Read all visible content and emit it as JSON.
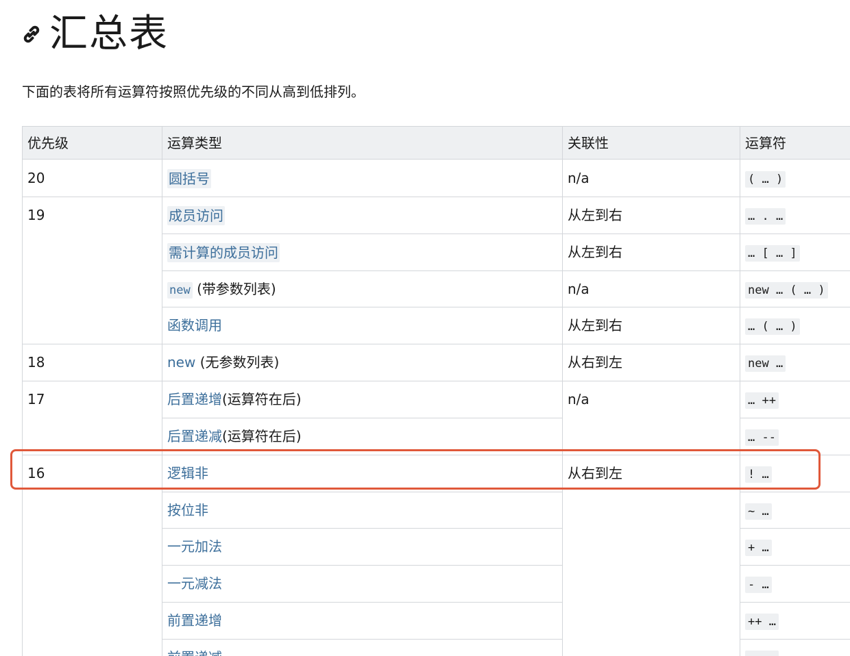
{
  "heading": {
    "title": "汇总表",
    "icon": "link-icon"
  },
  "intro": "下面的表将所有运算符按照优先级的不同从高到低排列。",
  "table": {
    "headers": [
      "优先级",
      "运算类型",
      "关联性",
      "运算符"
    ],
    "rows": [
      {
        "precedence": "20",
        "type": "圆括号",
        "assoc": "n/a",
        "op": "( … )"
      },
      {
        "precedence": "19",
        "type": "成员访问",
        "assoc": "从左到右",
        "op": "… . …"
      },
      {
        "type": "需计算的成员访问",
        "assoc": "从左到右",
        "op": "… [ … ]"
      },
      {
        "type_code": "new",
        "type_suffix": "(带参数列表)",
        "assoc": "n/a",
        "op": "new … ( … )"
      },
      {
        "type": "函数调用",
        "assoc": "从左到右",
        "op": "… ( … )"
      },
      {
        "precedence": "18",
        "type": "new",
        "type_suffix": "(无参数列表)",
        "assoc": "从右到左",
        "op": "new …"
      },
      {
        "precedence": "17",
        "type": "后置递增",
        "type_suffix": "(运算符在后)",
        "assoc": "n/a",
        "op": "… ++"
      },
      {
        "type": "后置递减",
        "type_suffix": "(运算符在后)",
        "op": "… --"
      },
      {
        "precedence": "16",
        "type": "逻辑非",
        "assoc": "从右到左",
        "op": "! …"
      },
      {
        "type": "按位非",
        "op": "~ …"
      },
      {
        "type": "一元加法",
        "op": "+ …"
      },
      {
        "type": "一元减法",
        "op": "- …"
      },
      {
        "type": "前置递增",
        "op": "++ …"
      },
      {
        "type": "前置递减",
        "op": "-- …"
      }
    ]
  },
  "colors": {
    "link": "#3d6f9b",
    "highlight": "#e0583a",
    "header_bg": "#eef0f2",
    "border": "#d3d6da"
  }
}
